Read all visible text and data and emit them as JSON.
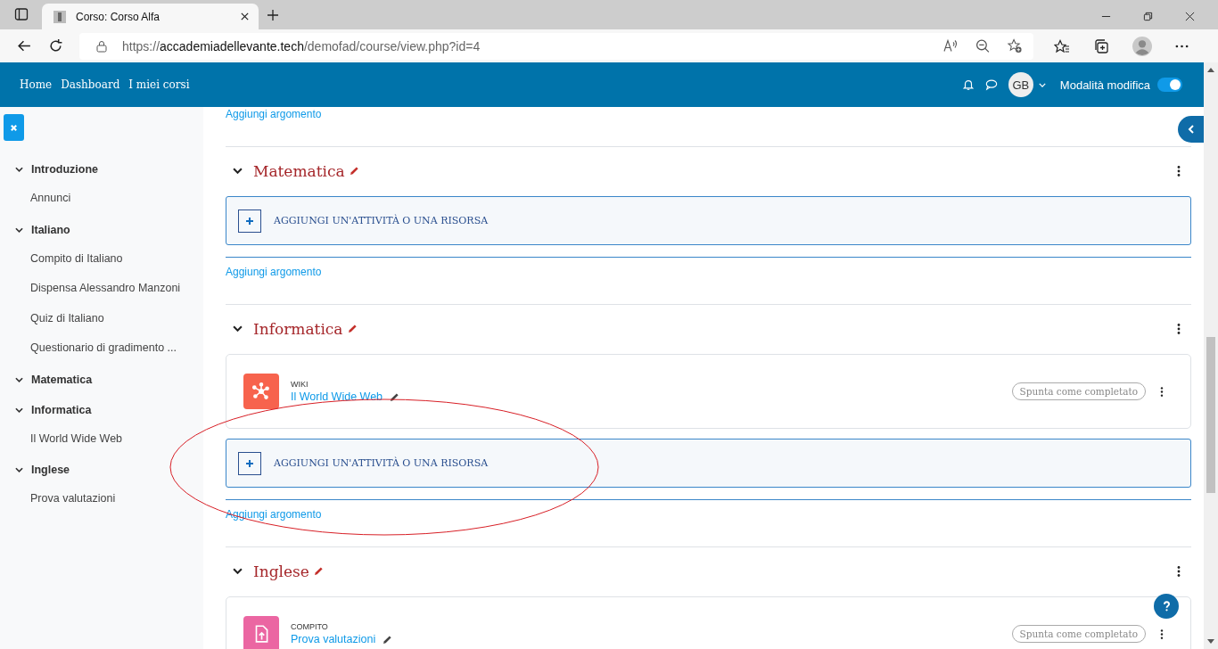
{
  "browser": {
    "tab_title": "Corso: Corso Alfa",
    "url_scheme": "https://",
    "url_host": "accademiadellevante.tech",
    "url_path": "/demofad/course/view.php?id=4"
  },
  "navbar": {
    "links": [
      "Home",
      "Dashboard",
      "I miei corsi"
    ],
    "avatar_initials": "GB",
    "edit_mode": {
      "label": "Modalità modifica",
      "on": true
    }
  },
  "sidebar": {
    "sections": [
      {
        "title": "Introduzione",
        "expanded": true,
        "items": [
          "Annunci"
        ]
      },
      {
        "title": "Italiano",
        "expanded": true,
        "items": [
          "Compito di Italiano",
          "Dispensa Alessandro Manzoni",
          "Quiz di Italiano",
          "Questionario di gradimento ..."
        ]
      },
      {
        "title": "Matematica",
        "expanded": true
      },
      {
        "title": "Informatica",
        "expanded": true,
        "items": [
          "Il World Wide Web"
        ]
      },
      {
        "title": "Inglese",
        "expanded": true,
        "items": [
          "Prova valutazioni"
        ]
      }
    ]
  },
  "course": {
    "top_link": "Aggiungi argomento",
    "sections": [
      {
        "title": "Matematica",
        "expanded": true,
        "add_label": "AGGIUNGI UN'ATTIVITÀ O UNA RISORSA",
        "add_topic_label": "Aggiungi argomento"
      },
      {
        "title": "Informatica",
        "expanded": true,
        "activities": [
          {
            "kind": "wiki",
            "type_label": "WIKI",
            "name": "Il World Wide Web",
            "color": "#f7634d",
            "completion_label": "Spunta come completato"
          }
        ],
        "add_label": "AGGIUNGI UN'ATTIVITÀ O UNA RISORSA",
        "add_topic_label": "Aggiungi argomento"
      },
      {
        "title": "Inglese",
        "expanded": true,
        "activities": [
          {
            "kind": "assignment",
            "type_label": "COMPITO",
            "name": "Prova valutazioni",
            "color": "#eb66a2",
            "completion_label": "Spunta come completato"
          }
        ]
      }
    ]
  }
}
